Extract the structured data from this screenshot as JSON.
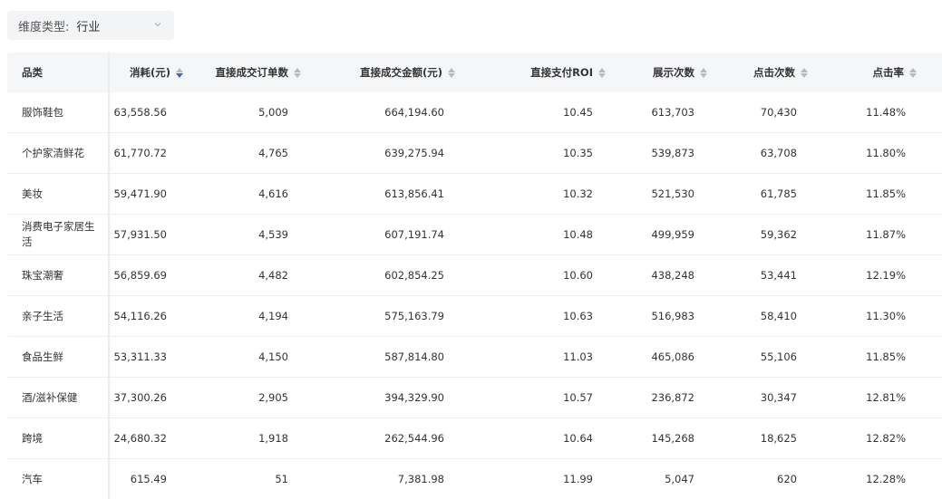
{
  "filter": {
    "label": "维度类型:",
    "value": "行业"
  },
  "colors": {
    "header_bg": "#f5f6f8",
    "active_sort": "#3b63d6",
    "inactive_sort": "#b7b9bf"
  },
  "table": {
    "headers": [
      "品类",
      "消耗(元)",
      "直接成交订单数",
      "直接成交金额(元)",
      "直接支付ROI",
      "展示次数",
      "点击次数",
      "点击率"
    ],
    "sorted_column": "消耗(元)",
    "sort_direction": "descending",
    "rows": [
      [
        "服饰鞋包",
        "63,558.56",
        "5,009",
        "664,194.60",
        "10.45",
        "613,703",
        "70,430",
        "11.48%"
      ],
      [
        "个护家清鲜花",
        "61,770.72",
        "4,765",
        "639,275.94",
        "10.35",
        "539,873",
        "63,708",
        "11.80%"
      ],
      [
        "美妆",
        "59,471.90",
        "4,616",
        "613,856.41",
        "10.32",
        "521,530",
        "61,785",
        "11.85%"
      ],
      [
        "消费电子家居生活",
        "57,931.50",
        "4,539",
        "607,191.74",
        "10.48",
        "499,959",
        "59,362",
        "11.87%"
      ],
      [
        "珠宝潮奢",
        "56,859.69",
        "4,482",
        "602,854.25",
        "10.60",
        "438,248",
        "53,441",
        "12.19%"
      ],
      [
        "亲子生活",
        "54,116.26",
        "4,194",
        "575,163.79",
        "10.63",
        "516,983",
        "58,410",
        "11.30%"
      ],
      [
        "食品生鲜",
        "53,311.33",
        "4,150",
        "587,814.80",
        "11.03",
        "465,086",
        "55,106",
        "11.85%"
      ],
      [
        "酒/滋补保健",
        "37,300.26",
        "2,905",
        "394,329.90",
        "10.57",
        "236,872",
        "30,347",
        "12.81%"
      ],
      [
        "跨境",
        "24,680.32",
        "1,918",
        "262,544.96",
        "10.64",
        "145,268",
        "18,625",
        "12.82%"
      ],
      [
        "汽车",
        "615.49",
        "51",
        "7,381.98",
        "11.99",
        "5,047",
        "620",
        "12.28%"
      ]
    ]
  }
}
